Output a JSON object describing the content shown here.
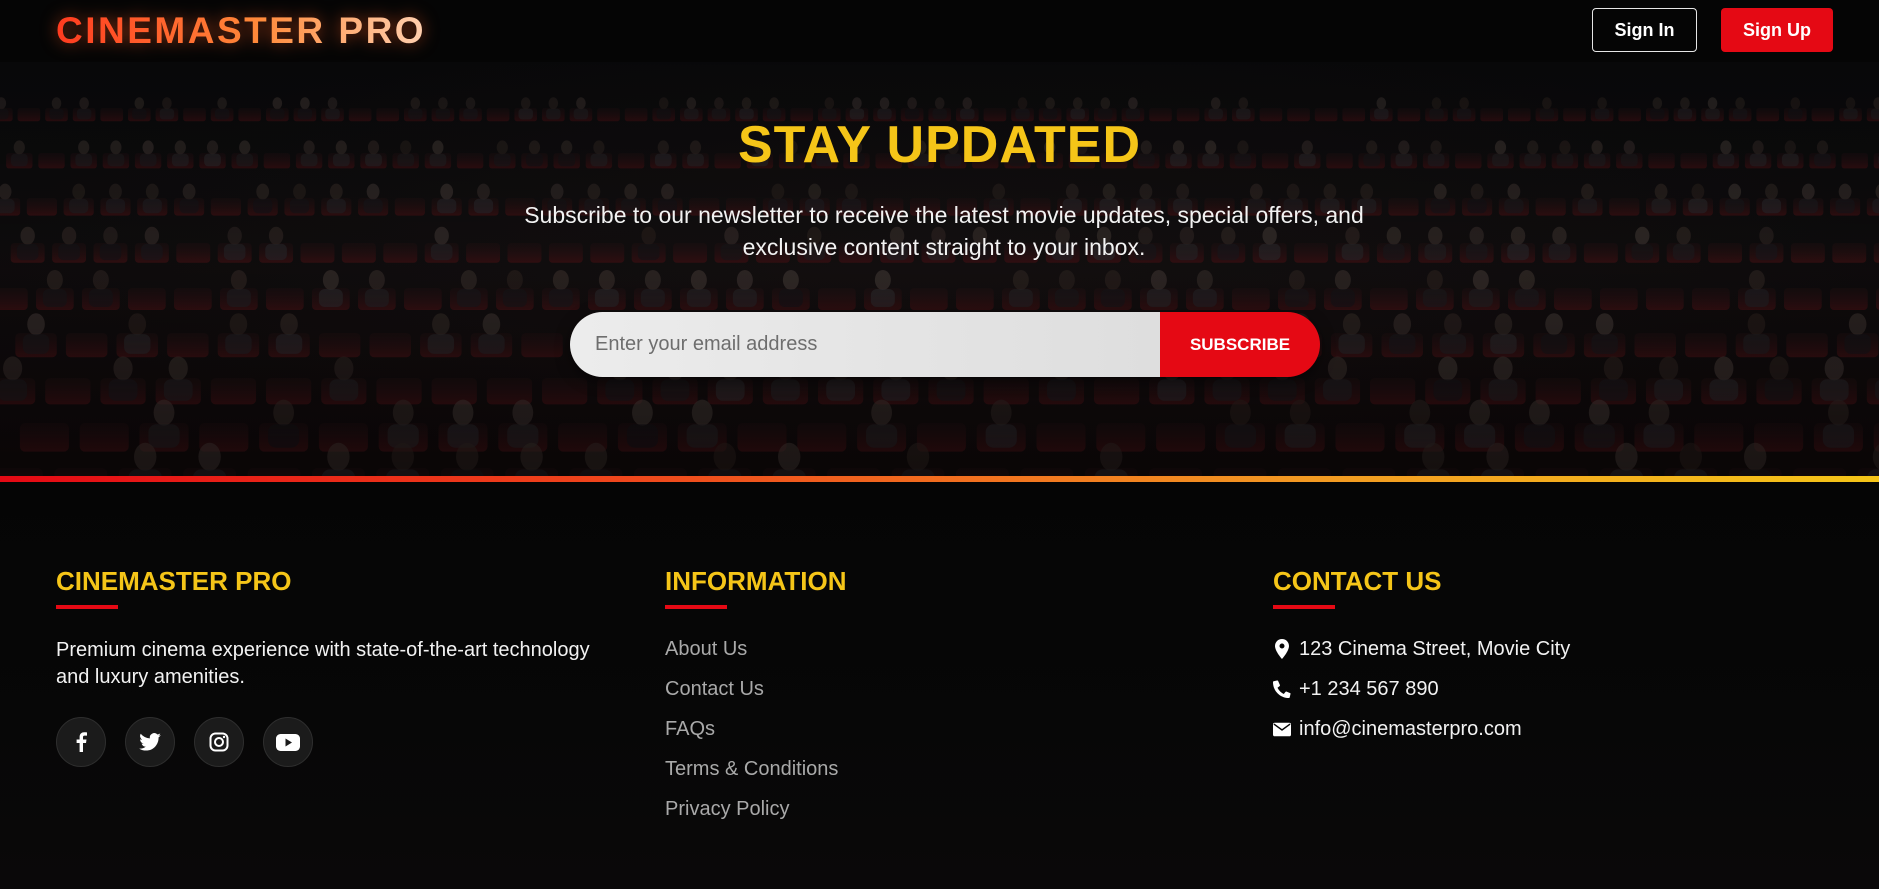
{
  "header": {
    "logo": "CINEMASTER PRO",
    "sign_in": "Sign In",
    "sign_up": "Sign Up"
  },
  "newsletter": {
    "title": "STAY UPDATED",
    "subtitle": "Subscribe to our newsletter to receive the latest movie updates, special offers, and exclusive content straight to your inbox.",
    "email_placeholder": "Enter your email address",
    "email_value": "",
    "subscribe_label": "SUBSCRIBE"
  },
  "footer": {
    "brand": {
      "heading": "CINEMASTER PRO",
      "description": "Premium cinema experience with state-of-the-art technology and luxury amenities.",
      "socials": [
        {
          "icon": "facebook-icon"
        },
        {
          "icon": "twitter-icon"
        },
        {
          "icon": "instagram-icon"
        },
        {
          "icon": "youtube-icon"
        }
      ]
    },
    "information": {
      "heading": "INFORMATION",
      "links": [
        "About Us",
        "Contact Us",
        "FAQs",
        "Terms & Conditions",
        "Privacy Policy"
      ]
    },
    "contact": {
      "heading": "CONTACT US",
      "address": "123 Cinema Street, Movie City",
      "phone": "+1 234 567 890",
      "email": "info@cinemasterpro.com"
    }
  },
  "colors": {
    "accent_red": "#e50914",
    "accent_yellow": "#f5c518",
    "background": "#050505"
  }
}
